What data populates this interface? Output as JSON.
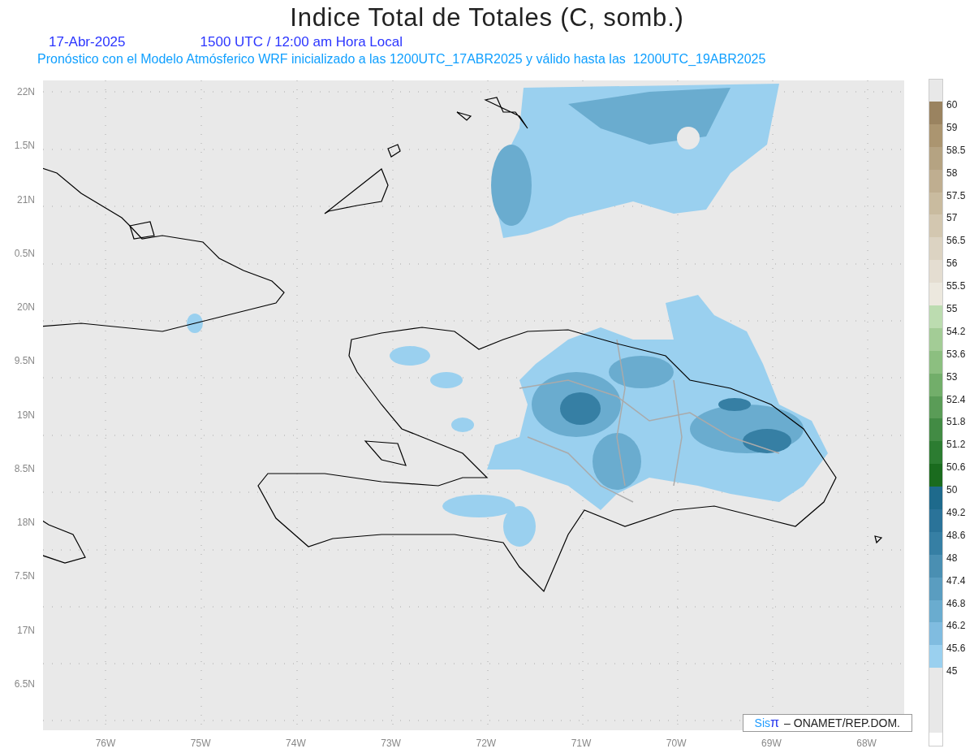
{
  "title": "Indice Total de Totales (C, somb.)",
  "date": "17-Abr-2025",
  "time": "1500 UTC / 12:00 am Hora Local",
  "forecast_note": "Pronóstico con el Modelo Atmósferico WRF inicializado a las 1200UTC_17ABR2025 y válido hasta las  1200UTC_19ABR2025",
  "y_axis_labels": [
    "22N",
    "1.5N",
    "21N",
    "0.5N",
    "20N",
    "9.5N",
    "19N",
    "8.5N",
    "18N",
    "7.5N",
    "17N",
    "6.5N"
  ],
  "x_axis_labels": [
    "76W",
    "75W",
    "74W",
    "73W",
    "72W",
    "71W",
    "70W",
    "69W",
    "68W"
  ],
  "credit": {
    "logo_text": "Sis",
    "logo_symbol": "π",
    "text": "– ONAMET/REP.DOM."
  },
  "colorbar": {
    "labels": [
      "60",
      "59",
      "58.5",
      "58",
      "57.5",
      "57",
      "56.5",
      "56",
      "55.5",
      "55",
      "54.2",
      "53.6",
      "53",
      "52.4",
      "51.8",
      "51.2",
      "50.6",
      "50",
      "49.2",
      "48.6",
      "48",
      "47.4",
      "46.8",
      "46.2",
      "45.6",
      "45"
    ],
    "bands": [
      {
        "color": "#e8e8e8"
      },
      {
        "color": "#9a8360"
      },
      {
        "color": "#ab9570"
      },
      {
        "color": "#b5a382"
      },
      {
        "color": "#bfae90"
      },
      {
        "color": "#c9bb9f"
      },
      {
        "color": "#d3c7b0"
      },
      {
        "color": "#dcd3c2"
      },
      {
        "color": "#e4ddd1"
      },
      {
        "color": "#ece8de"
      },
      {
        "color": "#bcdcb0"
      },
      {
        "color": "#a3cc96"
      },
      {
        "color": "#8cbf80"
      },
      {
        "color": "#72ae6a"
      },
      {
        "color": "#5a9c57"
      },
      {
        "color": "#428b44"
      },
      {
        "color": "#2c7c31"
      },
      {
        "color": "#1a6b1e"
      },
      {
        "color": "#1e6a8c"
      },
      {
        "color": "#2a7399"
      },
      {
        "color": "#367fa4"
      },
      {
        "color": "#4a8fb2"
      },
      {
        "color": "#5a9dc0"
      },
      {
        "color": "#6aaccf"
      },
      {
        "color": "#80bce0"
      },
      {
        "color": "#9ad0ef"
      },
      {
        "color": "#e8e8e8"
      }
    ]
  }
}
